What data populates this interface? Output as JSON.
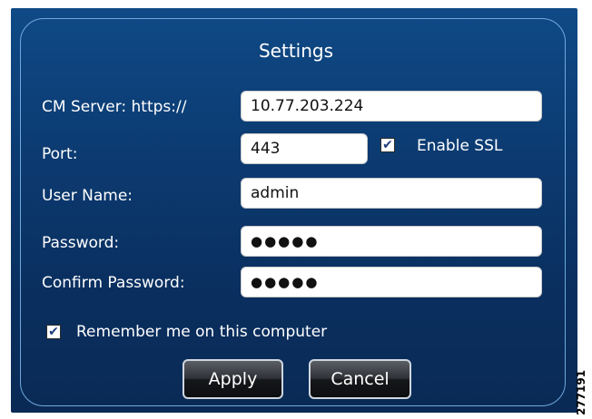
{
  "dialog": {
    "title": "Settings",
    "cm_server": {
      "label": "CM Server: https://",
      "value": "10.77.203.224"
    },
    "port": {
      "label": "Port:",
      "value": "443"
    },
    "enable_ssl": {
      "label": "Enable SSL",
      "checked": true
    },
    "user_name": {
      "label": "User Name:",
      "value": "admin"
    },
    "password": {
      "label": "Password:",
      "value": "●●●●●"
    },
    "confirm_password": {
      "label": "Confirm Password:",
      "value": "●●●●●"
    },
    "remember_me": {
      "label": "Remember me on this computer",
      "checked": true
    },
    "apply_label": "Apply",
    "cancel_label": "Cancel",
    "check_glyph": "✔"
  },
  "figure_id": "277191",
  "colors": {
    "dialog_bg": "#0c3b72",
    "panel_border": "#6fa8dc",
    "field_bg": "#ffffff"
  }
}
